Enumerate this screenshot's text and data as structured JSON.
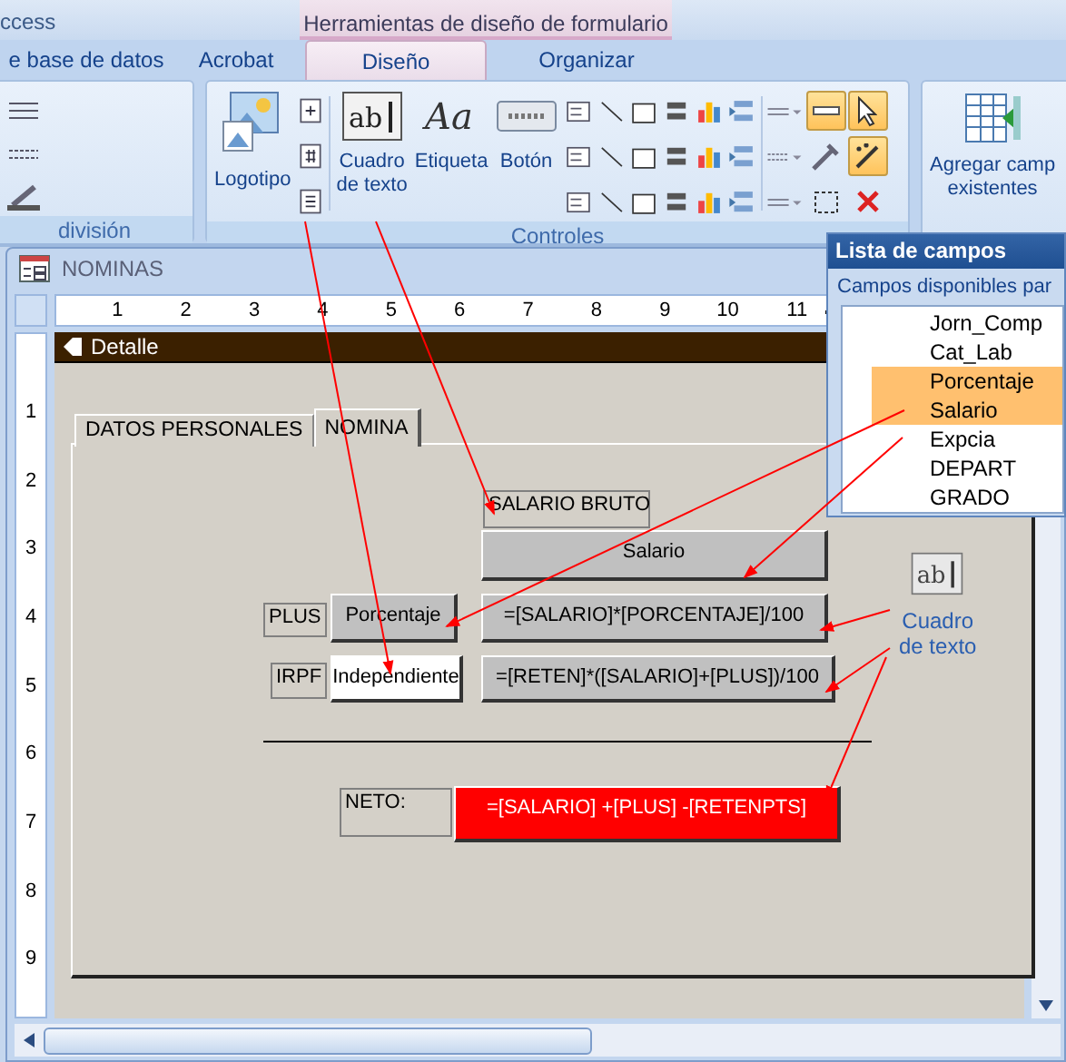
{
  "app_title": "ccess",
  "context_group": "Herramientas de diseño de formulario",
  "tabs": [
    {
      "label": "e base de datos",
      "selected": false
    },
    {
      "label": "Acrobat",
      "selected": false
    },
    {
      "label": "Diseño",
      "selected": true
    },
    {
      "label": "Organizar",
      "selected": false
    }
  ],
  "ribbon": {
    "groups": [
      {
        "kind": "partial",
        "label": "división"
      },
      {
        "kind": "controls",
        "label": "Controles",
        "large_buttons": [
          {
            "kind": "logo",
            "lines": [
              "Logotipo"
            ]
          },
          {
            "kind": "textbox",
            "icon_text": "ab",
            "lines": [
              "Cuadro",
              "de texto"
            ]
          },
          {
            "kind": "label",
            "icon_text": "Aa",
            "lines": [
              "Etiqueta"
            ]
          },
          {
            "kind": "button",
            "lines": [
              "Botón"
            ]
          }
        ],
        "tools": [
          {
            "on": true
          },
          {
            "on": true
          },
          {
            "on": false
          },
          {
            "on": true
          },
          {
            "on": false
          },
          {
            "on": false
          }
        ]
      },
      {
        "kind": "fields",
        "lines": [
          "Agregar camp",
          "existentes"
        ]
      }
    ]
  },
  "field_list": {
    "title": "Lista de campos",
    "subtitle": "Campos disponibles par",
    "items": [
      {
        "label": "Jorn_Comp",
        "selected": false
      },
      {
        "label": "Cat_Lab",
        "selected": false
      },
      {
        "label": "Porcentaje",
        "selected": true
      },
      {
        "label": "Salario",
        "selected": true
      },
      {
        "label": "Expcia",
        "selected": false
      },
      {
        "label": "DEPART",
        "selected": false
      },
      {
        "label": "GRADO",
        "selected": false
      }
    ]
  },
  "form_window": {
    "title": "NOMINAS",
    "ruler_marks": [
      "1",
      "2",
      "3",
      "4",
      "5",
      "6",
      "7",
      "8",
      "9",
      "10",
      "11"
    ],
    "vertical_ruler_marks": [
      "1",
      "2",
      "3",
      "4",
      "5",
      "6",
      "7",
      "8",
      "9"
    ],
    "section": "Detalle",
    "tabs": [
      {
        "label": "DATOS PERSONALES",
        "selected": false
      },
      {
        "label": "NOMINA",
        "selected": true
      }
    ],
    "controls": [
      {
        "kind": "label",
        "text": "SALARIO BRUTO"
      },
      {
        "kind": "textbox",
        "text": "Salario",
        "color": "#c0c0c0"
      },
      {
        "kind": "label",
        "text": "PLUS"
      },
      {
        "kind": "textbox",
        "text": "Porcentaje",
        "color": "#c0c0c0"
      },
      {
        "kind": "textbox",
        "text": "=[SALARIO]*[PORCENTAJE]/100",
        "color": "#c0c0c0"
      },
      {
        "kind": "label",
        "text": "IRPF"
      },
      {
        "kind": "textbox",
        "text": "Independiente",
        "color": "#ffffff"
      },
      {
        "kind": "textbox",
        "text": "=[RETEN]*([SALARIO]+[PLUS])/100",
        "color": "#c0c0c0"
      },
      {
        "kind": "line"
      },
      {
        "kind": "label",
        "text": "NETO:"
      },
      {
        "kind": "textbox",
        "text": "=[SALARIO] +[PLUS] -[RETENPTS]",
        "color": "#ff0000"
      }
    ]
  },
  "annotation": {
    "icon_text": "ab",
    "lines": [
      "Cuadro",
      "de texto"
    ]
  }
}
